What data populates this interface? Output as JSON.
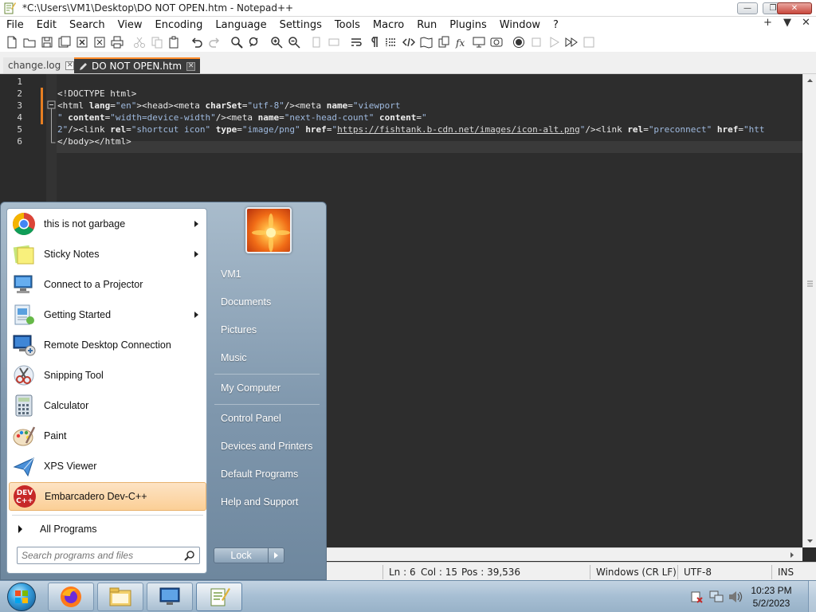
{
  "window": {
    "title": "*C:\\Users\\VM1\\Desktop\\DO NOT OPEN.htm - Notepad++",
    "buttons": {
      "minimize": "—",
      "maximize": "❐",
      "close": "✕"
    }
  },
  "menubar": {
    "items": [
      "File",
      "Edit",
      "Search",
      "View",
      "Encoding",
      "Language",
      "Settings",
      "Tools",
      "Macro",
      "Run",
      "Plugins",
      "Window",
      "?"
    ],
    "right_controls": [
      "+",
      "▼",
      "✕"
    ]
  },
  "toolbar": {
    "icons": [
      "new-file-icon",
      "open-file-icon",
      "save-icon",
      "save-all-icon",
      "close-icon",
      "close-all-icon",
      "print-icon",
      "cut-icon",
      "copy-icon",
      "paste-icon",
      "undo-icon",
      "redo-icon",
      "find-icon",
      "replace-icon",
      "zoom-in-icon",
      "zoom-out-icon",
      "sync-vertical-icon",
      "sync-horizontal-icon",
      "word-wrap-icon",
      "show-all-characters-icon",
      "indent-guide-icon",
      "xml-tag-icon",
      "document-map-icon",
      "document-list-icon",
      "function-list-icon",
      "folder-as-workspace-icon",
      "monitoring-icon",
      "macro-record-icon",
      "macro-stop-icon",
      "macro-play-icon",
      "macro-run-multiple-icon",
      "macro-save-icon"
    ]
  },
  "tabs": [
    {
      "label": "change.log",
      "active": false
    },
    {
      "label": "DO NOT OPEN.htm",
      "active": true
    }
  ],
  "editor": {
    "line_numbers": [
      "1",
      "2",
      "3",
      "4",
      "5",
      "6"
    ],
    "lines": {
      "l2": {
        "text": "<!DOCTYPE html>"
      },
      "l3": {
        "p1": "<html ",
        "a1": "lang",
        "e1": "=",
        "s1": "\"en\"",
        "p2": "><head><meta ",
        "a2": "charSet",
        "e2": "=",
        "s2": "\"utf-8\"",
        "p3": "/><meta ",
        "a3": "name",
        "e3": "=",
        "s3": "\"viewport"
      },
      "l4": {
        "s1": "\" ",
        "a1": "content",
        "e1": "=",
        "s2": "\"width=device-width\"",
        "p1": "/><meta ",
        "a2": "name",
        "e2": "=",
        "s3": "\"next-head-count\"",
        "sp": " ",
        "a3": "content",
        "e3": "=",
        "s4": "\""
      },
      "l5": {
        "s1": "2\"",
        "p1": "/><link ",
        "a1": "rel",
        "e1": "=",
        "s2": "\"shortcut icon\"",
        "sp1": " ",
        "a2": "type",
        "e2": "=",
        "s3": "\"image/png\"",
        "sp2": " ",
        "a3": "href",
        "e3": "=",
        "s4a": "\"",
        "url": "https://fishtank.b-cdn.net/images/icon-alt.png",
        "s4b": "\"",
        "p2": "/><link ",
        "a4": "rel",
        "e4": "=",
        "s5": "\"preconnect\"",
        "sp3": " ",
        "a5": "href",
        "e5": "=",
        "s6": "\"htt"
      },
      "l6": {
        "text": "</body></html>"
      }
    }
  },
  "statusbar": {
    "ln": "Ln : 6",
    "col": "Col : 15",
    "pos": "Pos : 39,536",
    "eol": "Windows (CR LF)",
    "encoding": "UTF-8",
    "mode": "INS"
  },
  "start_menu": {
    "programs": [
      {
        "label": "this is not garbage",
        "icon": "chrome-icon",
        "submenu": true
      },
      {
        "label": "Sticky Notes",
        "icon": "sticky-notes-icon",
        "submenu": true
      },
      {
        "label": "Connect to a Projector",
        "icon": "projector-icon",
        "submenu": false
      },
      {
        "label": "Getting Started",
        "icon": "getting-started-icon",
        "submenu": true
      },
      {
        "label": "Remote Desktop Connection",
        "icon": "remote-desktop-icon",
        "submenu": false
      },
      {
        "label": "Snipping Tool",
        "icon": "snipping-tool-icon",
        "submenu": false
      },
      {
        "label": "Calculator",
        "icon": "calculator-icon",
        "submenu": false
      },
      {
        "label": "Paint",
        "icon": "paint-icon",
        "submenu": false
      },
      {
        "label": "XPS Viewer",
        "icon": "xps-viewer-icon",
        "submenu": false
      },
      {
        "label": "Embarcadero Dev-C++",
        "icon": "devcpp-icon",
        "submenu": false,
        "highlighted": true
      }
    ],
    "devcpp_icon_text": {
      "line1": "DEV",
      "line2": "C++"
    },
    "all_programs": "All Programs",
    "search_placeholder": "Search programs and files",
    "right_links": [
      "VM1",
      "Documents",
      "Pictures",
      "Music",
      "My Computer",
      "Control Panel",
      "Devices and Printers",
      "Default Programs",
      "Help and Support"
    ],
    "lock_button": "Lock"
  },
  "taskbar": {
    "buttons": [
      "firefox-icon",
      "file-explorer-icon",
      "remote-desktop-icon",
      "notepad-plus-plus-icon"
    ],
    "tray_icons": [
      "action-center-icon",
      "network-icon",
      "volume-icon"
    ],
    "clock_time": "10:23 PM",
    "clock_date": "5/2/2023"
  },
  "colors": {
    "editor_bg": "#2d2d2d",
    "accent_orange": "#ff8c2a",
    "start_menu_bg": "#8aa2b8",
    "highlight": "#fbcf96"
  }
}
